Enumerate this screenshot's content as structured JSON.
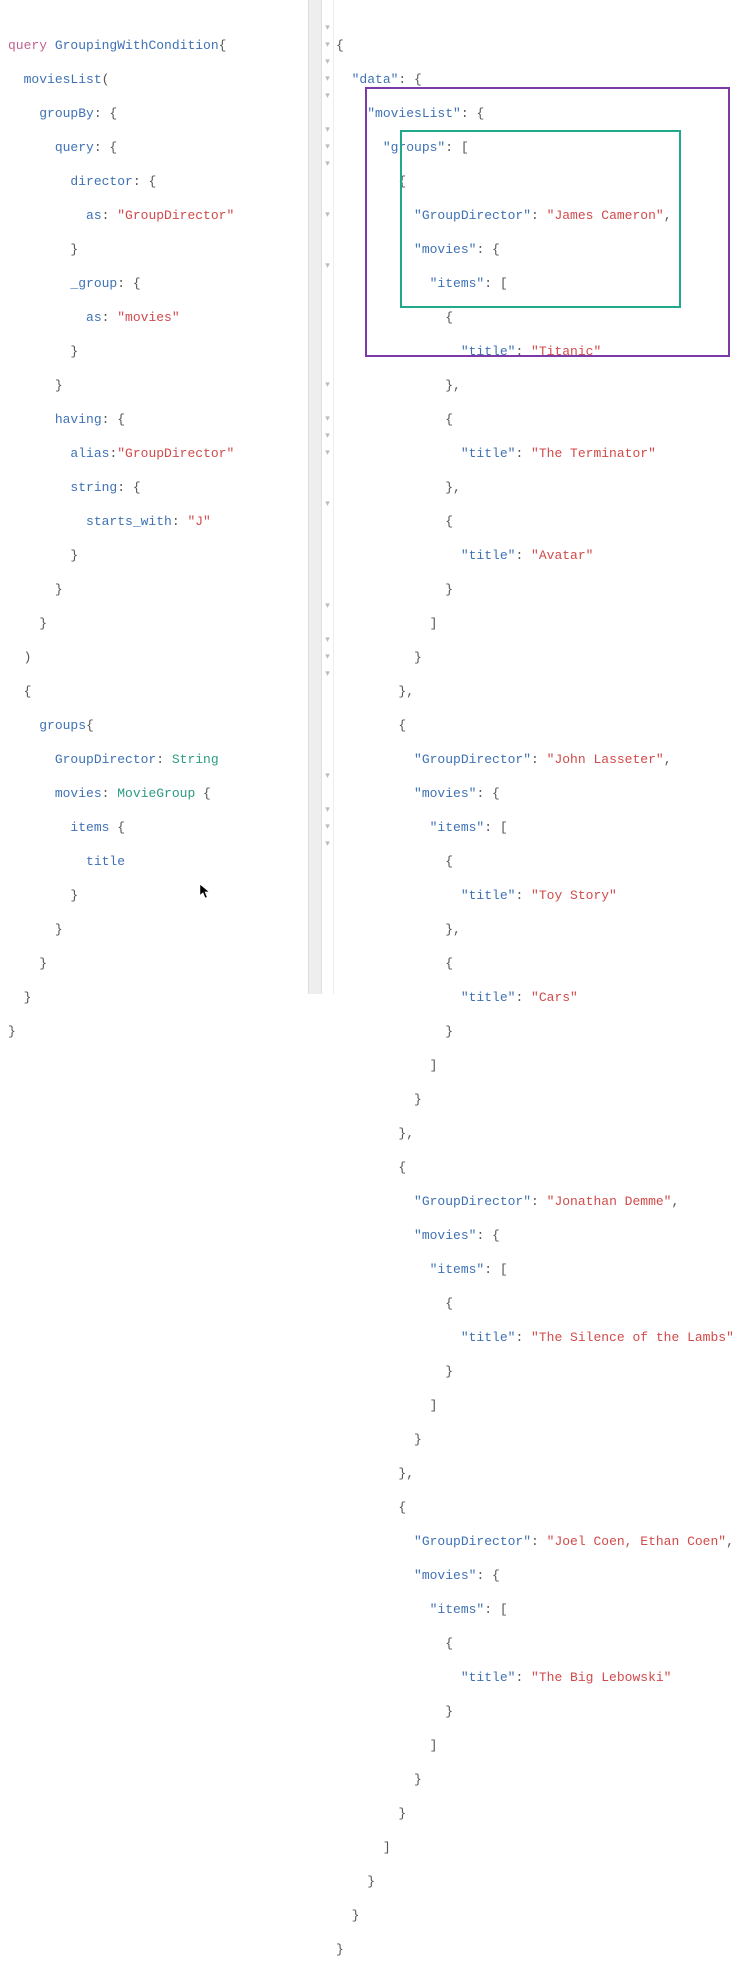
{
  "query": {
    "keyword_query": "query",
    "operation_name": "GroupingWithCondition",
    "field_moviesList": "moviesList",
    "arg_groupBy": "groupBy",
    "arg_query": "query",
    "arg_director": "director",
    "arg_as": "as",
    "val_GroupDirector": "\"GroupDirector\"",
    "arg_group": "_group",
    "val_movies": "\"movies\"",
    "arg_having": "having",
    "arg_alias": "alias",
    "val_alias_GroupDirector": "\"GroupDirector\"",
    "arg_string": "string",
    "arg_starts_with": "starts_with",
    "val_J": "\"J\"",
    "sel_groups": "groups",
    "sel_GroupDirector": "GroupDirector",
    "type_String": "String",
    "sel_movies": "movies",
    "type_MovieGroup": "MovieGroup",
    "sel_items": "items",
    "sel_title": "title"
  },
  "response": {
    "key_data": "\"data\"",
    "key_moviesList": "\"moviesList\"",
    "key_groups": "\"groups\"",
    "key_GroupDirector": "\"GroupDirector\"",
    "key_movies": "\"movies\"",
    "key_items": "\"items\"",
    "key_title": "\"title\"",
    "directors": {
      "d0": "\"James Cameron\"",
      "d1": "\"John Lasseter\"",
      "d2": "\"Jonathan Demme\"",
      "d3": "\"Joel Coen, Ethan Coen\""
    },
    "titles": {
      "t0": "\"Titanic\"",
      "t1": "\"The Terminator\"",
      "t2": "\"Avatar\"",
      "t3": "\"Toy Story\"",
      "t4": "\"Cars\"",
      "t5": "\"The Silence of the Lambs\"",
      "t6": "\"The Big Lebowski\""
    }
  },
  "chart_data": {
    "type": "table",
    "description": "GraphQL query and JSON response showing movies grouped by director, filtered where director name starts with J",
    "groups": [
      {
        "GroupDirector": "James Cameron",
        "movies": [
          "Titanic",
          "The Terminator",
          "Avatar"
        ]
      },
      {
        "GroupDirector": "John Lasseter",
        "movies": [
          "Toy Story",
          "Cars"
        ]
      },
      {
        "GroupDirector": "Jonathan Demme",
        "movies": [
          "The Silence of the Lambs"
        ]
      },
      {
        "GroupDirector": "Joel Coen, Ethan Coen",
        "movies": [
          "The Big Lebowski"
        ]
      }
    ]
  }
}
